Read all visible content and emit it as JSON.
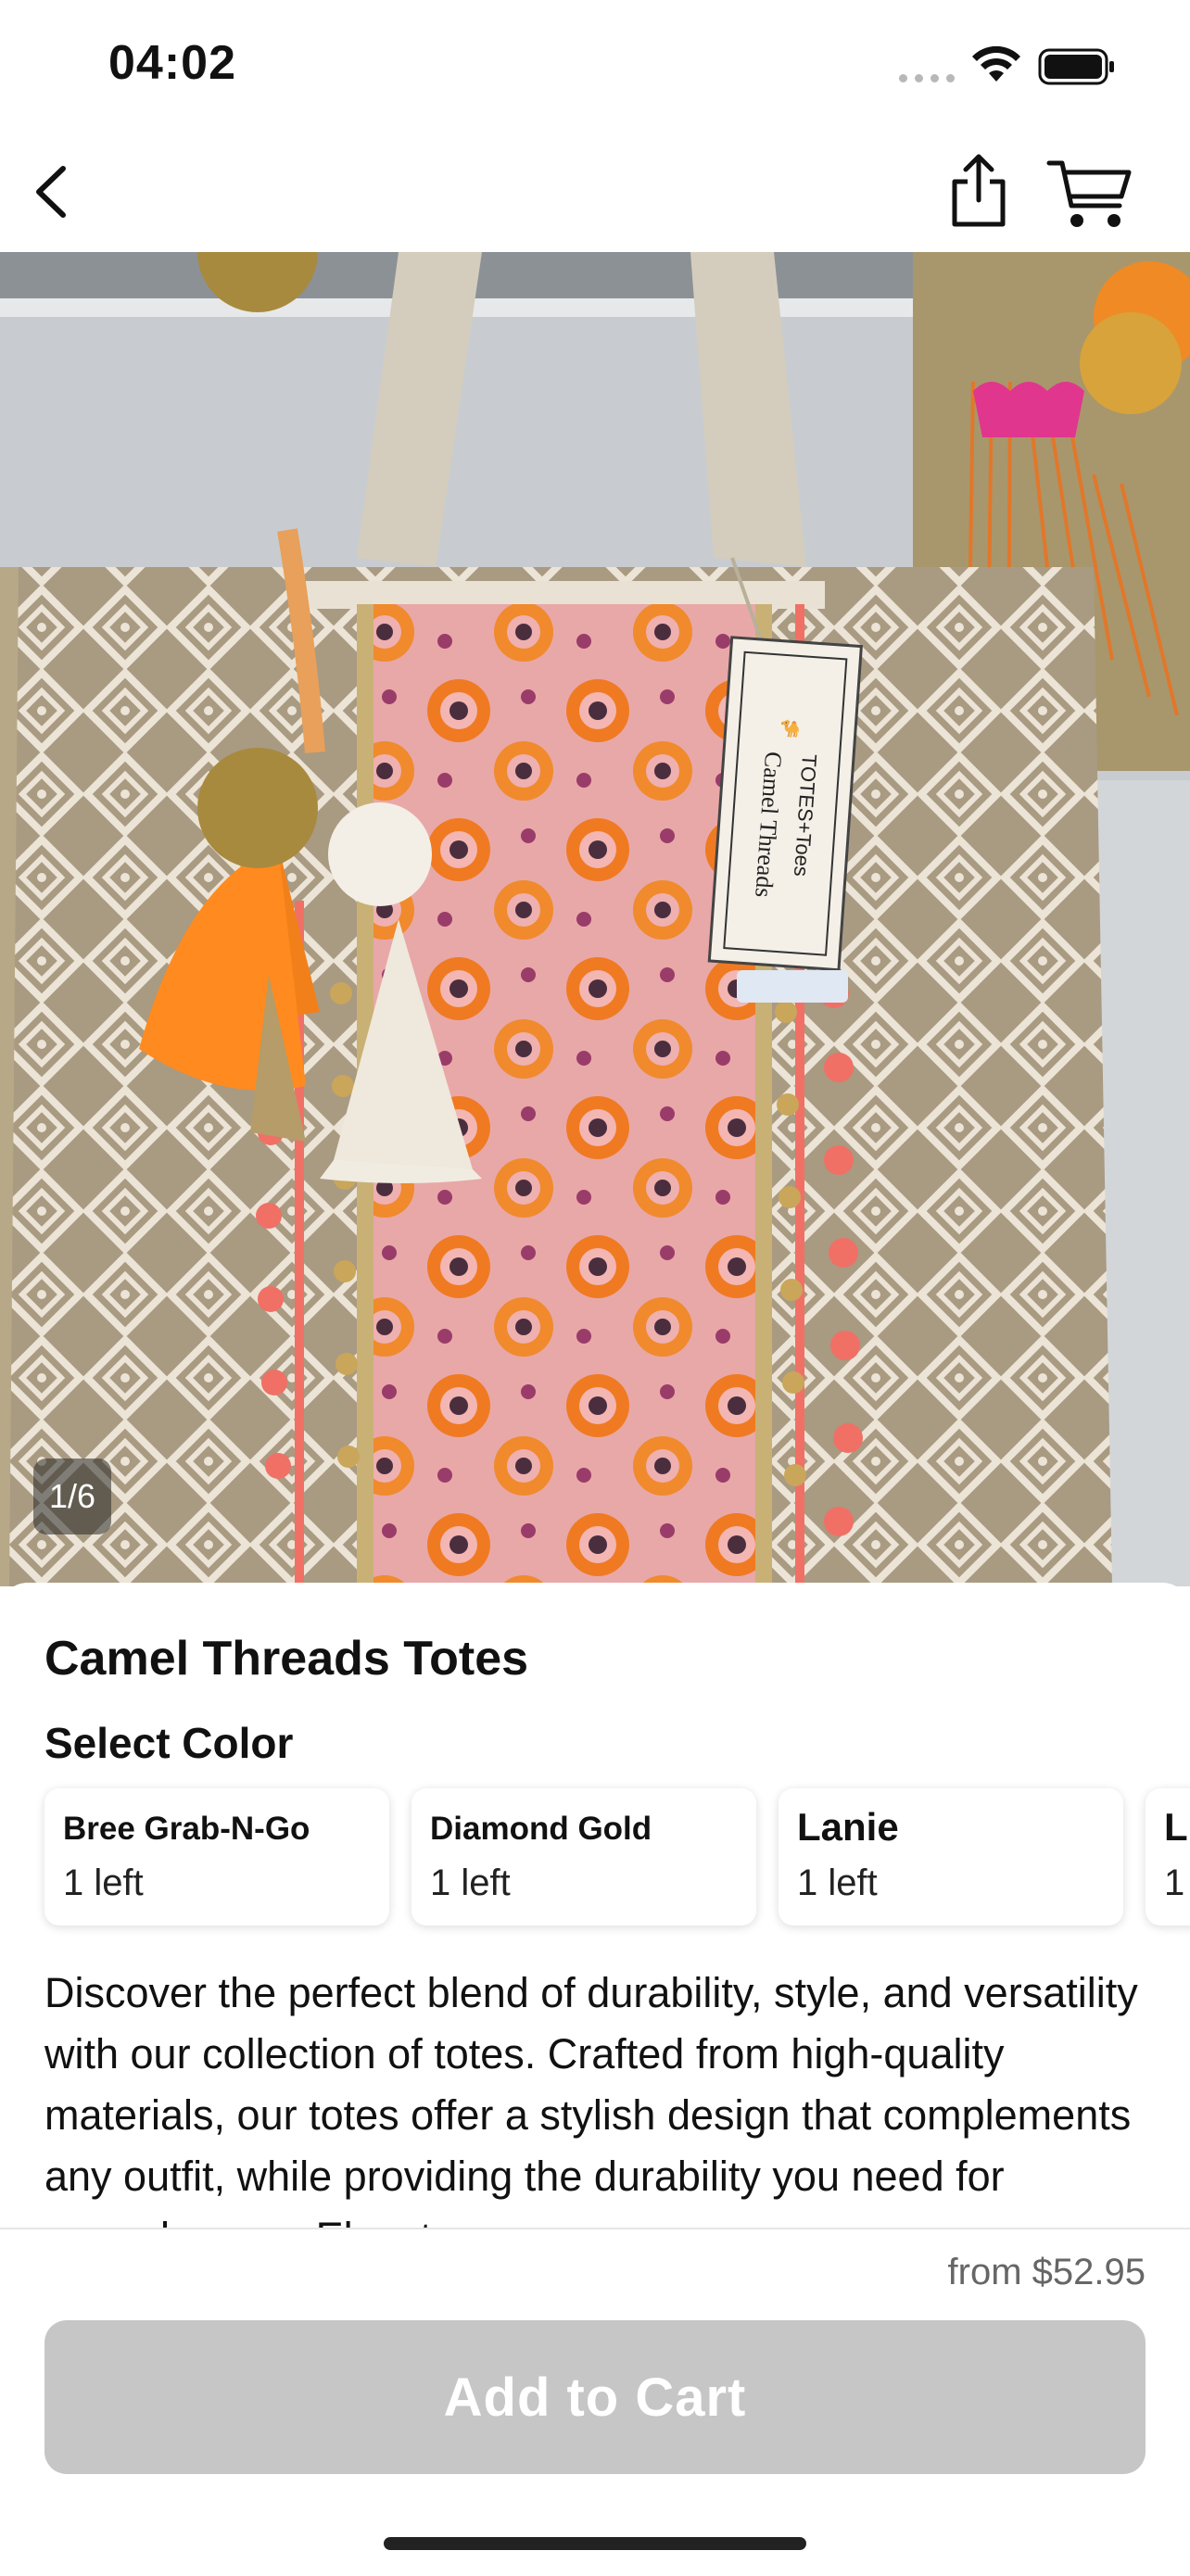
{
  "status_bar": {
    "time": "04:02"
  },
  "gallery": {
    "counter": "1/6"
  },
  "product": {
    "title": "Camel Threads Totes",
    "select_color_label": "Select Color",
    "colors": [
      {
        "name": "Bree Grab-N-Go",
        "stock": "1 left"
      },
      {
        "name": "Diamond Gold",
        "stock": "1 left"
      },
      {
        "name": "Lanie",
        "stock": "1 left"
      },
      {
        "name": "Lu",
        "stock": "1"
      }
    ],
    "description": "Discover the perfect blend of durability, style, and versatility with our collection of totes. Crafted from high-quality materials, our totes offer a stylish design that complements any outfit, while providing the durability you need for everyday use. Elevate"
  },
  "purchase": {
    "price": "from $52.95",
    "add_to_cart_label": "Add to Cart"
  },
  "tag": {
    "line1": "Camel Threads",
    "line2": "TOTES+Toes"
  }
}
